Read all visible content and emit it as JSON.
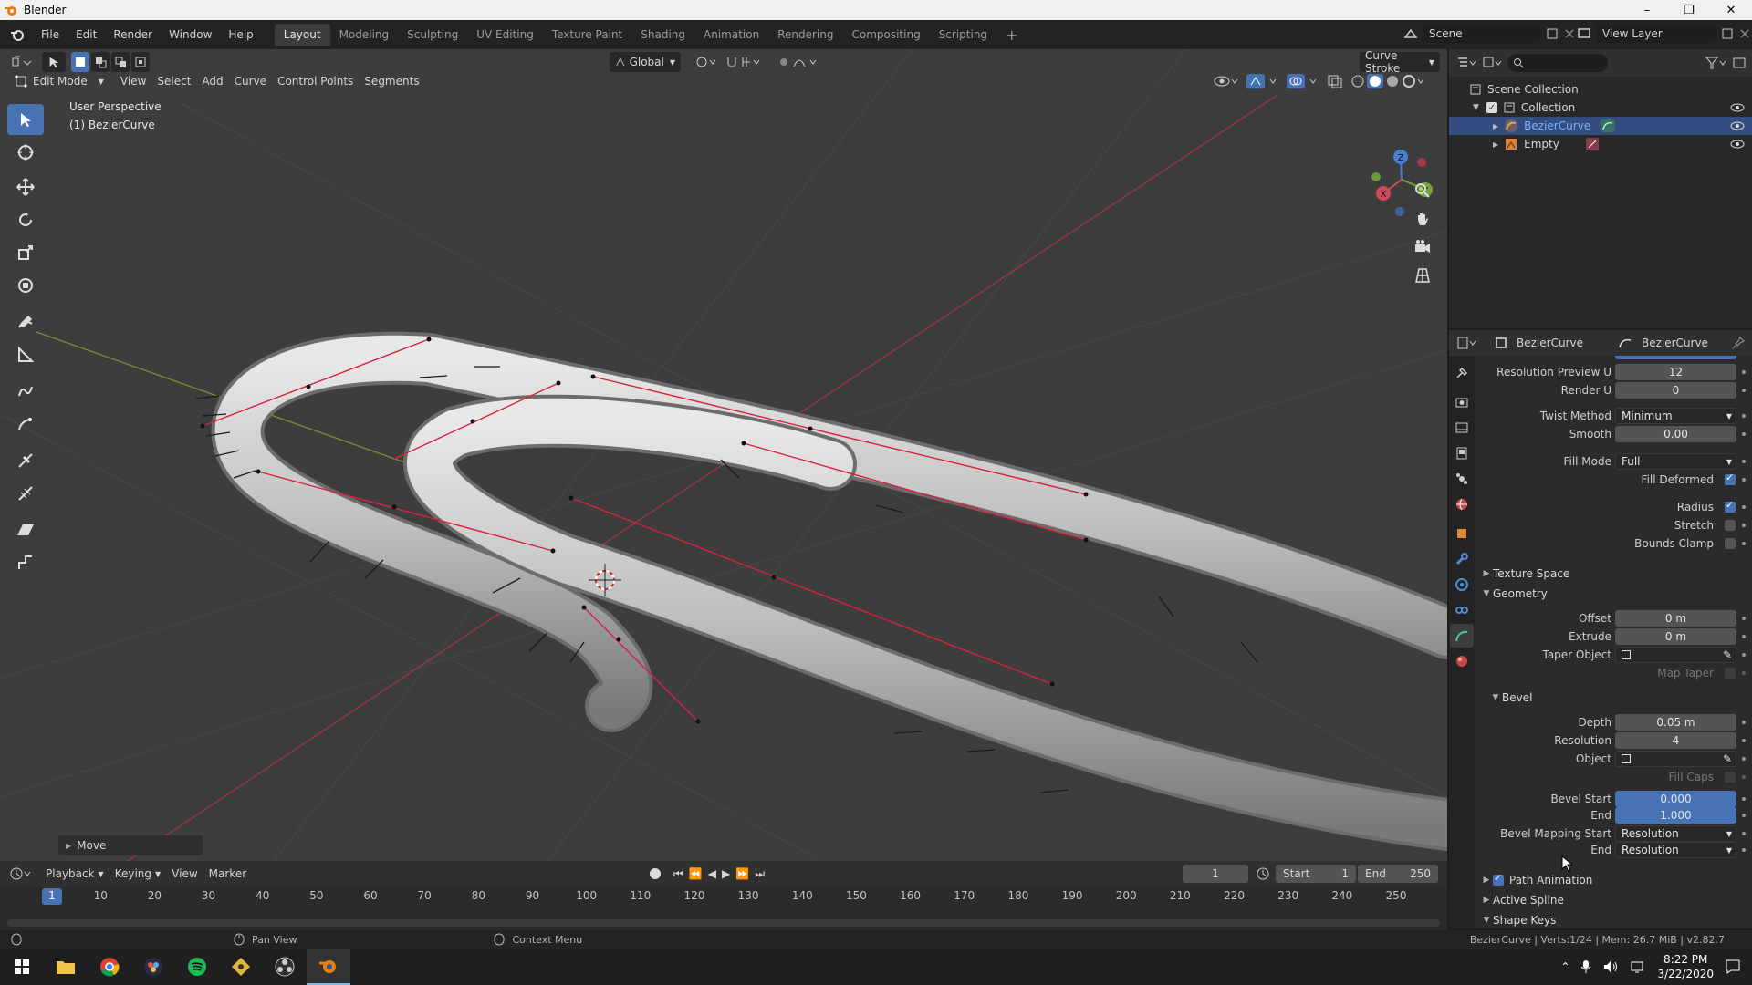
{
  "window": {
    "title": "Blender",
    "minimize": "–",
    "maximize": "❐",
    "close": "✕"
  },
  "menu": [
    "File",
    "Edit",
    "Render",
    "Window",
    "Help"
  ],
  "workspaces": [
    {
      "label": "Layout",
      "active": true
    },
    {
      "label": "Modeling"
    },
    {
      "label": "Sculpting"
    },
    {
      "label": "UV Editing"
    },
    {
      "label": "Texture Paint"
    },
    {
      "label": "Shading"
    },
    {
      "label": "Animation"
    },
    {
      "label": "Rendering"
    },
    {
      "label": "Compositing"
    },
    {
      "label": "Scripting"
    }
  ],
  "add_workspace": "+",
  "scene": {
    "value": "Scene"
  },
  "view_layer": {
    "value": "View Layer"
  },
  "viewport": {
    "mode": "Edit Mode",
    "menus": [
      "View",
      "Select",
      "Add",
      "Curve",
      "Control Points",
      "Segments"
    ],
    "orientation": "Global",
    "draw_tool": "Curve Stroke",
    "view_name": "User Perspective",
    "object_name": "(1) BezierCurve",
    "last_op": "Move",
    "gizmo": {
      "x": "X",
      "y": "Y",
      "z": "Z"
    }
  },
  "outliner": {
    "search_placeholder": "",
    "rows": [
      {
        "label": "Scene Collection",
        "indent": 0
      },
      {
        "label": "Collection",
        "indent": 1
      },
      {
        "label": "BezierCurve",
        "indent": 2,
        "selected": true
      },
      {
        "label": "Empty",
        "indent": 2
      }
    ]
  },
  "properties": {
    "breadcrumb_object": "BezierCurve",
    "breadcrumb_data": "BezierCurve",
    "rows": {
      "res_preview_u": {
        "label": "Resolution Preview U",
        "value": "12"
      },
      "render_u": {
        "label": "Render U",
        "value": "0"
      },
      "twist_method": {
        "label": "Twist Method",
        "value": "Minimum"
      },
      "smooth": {
        "label": "Smooth",
        "value": "0.00"
      },
      "fill_mode": {
        "label": "Fill Mode",
        "value": "Full"
      },
      "fill_deformed": {
        "label": "Fill Deformed"
      },
      "radius": {
        "label": "Radius"
      },
      "stretch": {
        "label": "Stretch"
      },
      "bounds_clamp": {
        "label": "Bounds Clamp"
      },
      "texture_space": "Texture Space",
      "geometry": "Geometry",
      "offset": {
        "label": "Offset",
        "value": "0 m"
      },
      "extrude": {
        "label": "Extrude",
        "value": "0 m"
      },
      "taper_object": {
        "label": "Taper Object"
      },
      "map_taper": {
        "label": "Map Taper"
      },
      "bevel": "Bevel",
      "depth": {
        "label": "Depth",
        "value": "0.05 m"
      },
      "resolution": {
        "label": "Resolution",
        "value": "4"
      },
      "object": {
        "label": "Object"
      },
      "fill_caps": {
        "label": "Fill Caps"
      },
      "bevel_start": {
        "label": "Bevel Start",
        "value": "0.000"
      },
      "bevel_end": {
        "label": "End",
        "value": "1.000"
      },
      "bevel_map_start": {
        "label": "Bevel Mapping Start",
        "value": "Resolution"
      },
      "bevel_map_end": {
        "label": "End",
        "value": "Resolution"
      },
      "path_animation": "Path Animation",
      "active_spline": "Active Spline",
      "shape_keys": "Shape Keys"
    }
  },
  "timeline": {
    "menus": [
      "Playback",
      "Keying",
      "View",
      "Marker"
    ],
    "current_frame": "1",
    "start_label": "Start",
    "start": "1",
    "end_label": "End",
    "end": "250",
    "ticks": [
      "1",
      "10",
      "20",
      "30",
      "40",
      "50",
      "60",
      "70",
      "80",
      "90",
      "100",
      "110",
      "120",
      "130",
      "140",
      "150",
      "160",
      "170",
      "180",
      "190",
      "200",
      "210",
      "220",
      "230",
      "240",
      "250"
    ]
  },
  "status": {
    "pan": "Pan View",
    "context": "Context Menu",
    "info": "BezierCurve | Verts:1/24 | Mem: 26.7 MiB | v2.82.7"
  },
  "taskbar": {
    "time": "8:22 PM",
    "date": "3/22/2020"
  }
}
